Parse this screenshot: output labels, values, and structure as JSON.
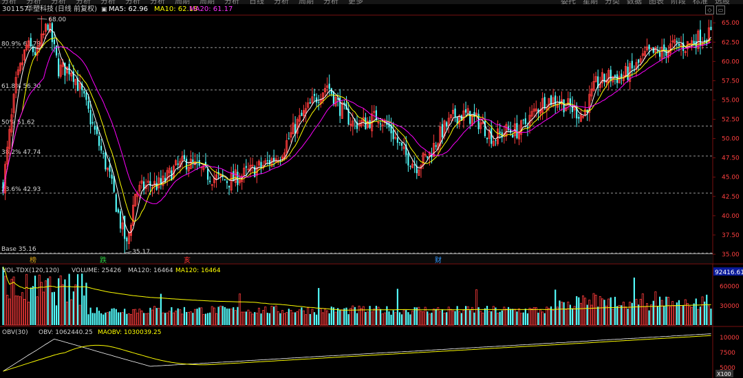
{
  "topbar": {
    "items": [
      "分析",
      "分析",
      "分析",
      "分析",
      "分析",
      "分析",
      "分析",
      "周期",
      "周期",
      "分析",
      "日线",
      "分析",
      "周期",
      "分析",
      "更多"
    ],
    "right_items": [
      "委托",
      "星期",
      "分类",
      "数据",
      "图表",
      "阶段",
      "标准",
      "选股"
    ]
  },
  "header": {
    "code": "301157",
    "name": "华塑科技",
    "period": "(日线 前复权)",
    "ma5_label": "MA5: 62.96",
    "ma10_label": "MA10: 62.18",
    "ma20_label": "MA20: 61.17"
  },
  "main_panel": {
    "high_marker": "68.00",
    "low_marker": "35.17",
    "fib_levels": [
      {
        "label": "80.9% 61.79",
        "value": 61.79
      },
      {
        "label": "61.8% 56.30",
        "value": 56.3
      },
      {
        "label": "50% 51.62",
        "value": 51.62
      },
      {
        "label": "38.2% 47.74",
        "value": 47.74
      },
      {
        "label": "23.6% 42.93",
        "value": 42.93
      },
      {
        "label": "Base 35.16",
        "value": 35.16
      }
    ],
    "price_axis": [
      "65.00",
      "62.50",
      "60.00",
      "57.50",
      "55.00",
      "52.50",
      "50.00",
      "47.50",
      "45.00",
      "42.50",
      "40.00",
      "37.50",
      "35.00"
    ],
    "event_marks": [
      {
        "text": "榜",
        "color": "#d4a017"
      },
      {
        "text": "跌",
        "color": "#2ecc40"
      },
      {
        "text": "亥",
        "color": "#ff3030"
      },
      {
        "text": "财",
        "color": "#3399ff"
      }
    ]
  },
  "volume_panel": {
    "title": "VOL-TDX(120,120)",
    "volume_label": "VOLUME: 25426",
    "ma120_label": "MA120: 16464",
    "ma120b_label": "MA120: 16464",
    "axis": [
      "60000",
      "30000"
    ],
    "max_readout": "92416.61"
  },
  "obv_panel": {
    "title": "OBV(30)",
    "obv_label": "OBV: 1062440.25",
    "maobv_label": "MAOBV: 1030039.25",
    "axis": [
      "10000",
      "7500",
      "5000"
    ],
    "unit": "X100"
  },
  "colors": {
    "up": "#ff3c3c",
    "down": "#54ffff",
    "ma5": "#ffffff",
    "ma10": "#ffff00",
    "ma20": "#ff00ff",
    "grid": "#9a9a9a",
    "panel_border": "#7a1010"
  },
  "chart_data": {
    "type": "candlestick",
    "y_range": [
      35.0,
      66.0
    ],
    "price_path_anchors": [
      [
        0,
        44
      ],
      [
        6,
        57
      ],
      [
        11,
        62
      ],
      [
        16,
        61
      ],
      [
        21,
        65
      ],
      [
        26,
        59
      ],
      [
        32,
        59
      ],
      [
        38,
        55
      ],
      [
        44,
        50
      ],
      [
        50,
        45
      ],
      [
        55,
        39
      ],
      [
        58,
        36
      ],
      [
        62,
        43
      ],
      [
        68,
        44
      ],
      [
        74,
        44
      ],
      [
        80,
        46
      ],
      [
        86,
        47
      ],
      [
        92,
        46
      ],
      [
        98,
        45
      ],
      [
        106,
        44.5
      ],
      [
        114,
        45.5
      ],
      [
        122,
        46.5
      ],
      [
        130,
        48
      ],
      [
        138,
        52
      ],
      [
        146,
        55
      ],
      [
        152,
        57
      ],
      [
        158,
        54
      ],
      [
        164,
        52
      ],
      [
        170,
        52
      ],
      [
        176,
        53
      ],
      [
        182,
        51
      ],
      [
        188,
        48
      ],
      [
        194,
        46.5
      ],
      [
        200,
        48
      ],
      [
        206,
        51
      ],
      [
        212,
        53
      ],
      [
        218,
        53
      ],
      [
        224,
        52
      ],
      [
        230,
        50
      ],
      [
        236,
        51
      ],
      [
        242,
        51
      ],
      [
        248,
        53
      ],
      [
        254,
        55
      ],
      [
        260,
        55
      ],
      [
        266,
        54
      ],
      [
        272,
        53
      ],
      [
        278,
        57
      ],
      [
        284,
        58
      ],
      [
        290,
        58
      ],
      [
        296,
        59
      ],
      [
        302,
        61
      ],
      [
        308,
        61
      ],
      [
        314,
        62
      ],
      [
        320,
        62
      ],
      [
        326,
        63
      ],
      [
        332,
        63.5
      ]
    ],
    "candles": 333,
    "ma_series": [
      "MA5",
      "MA10",
      "MA20"
    ]
  }
}
